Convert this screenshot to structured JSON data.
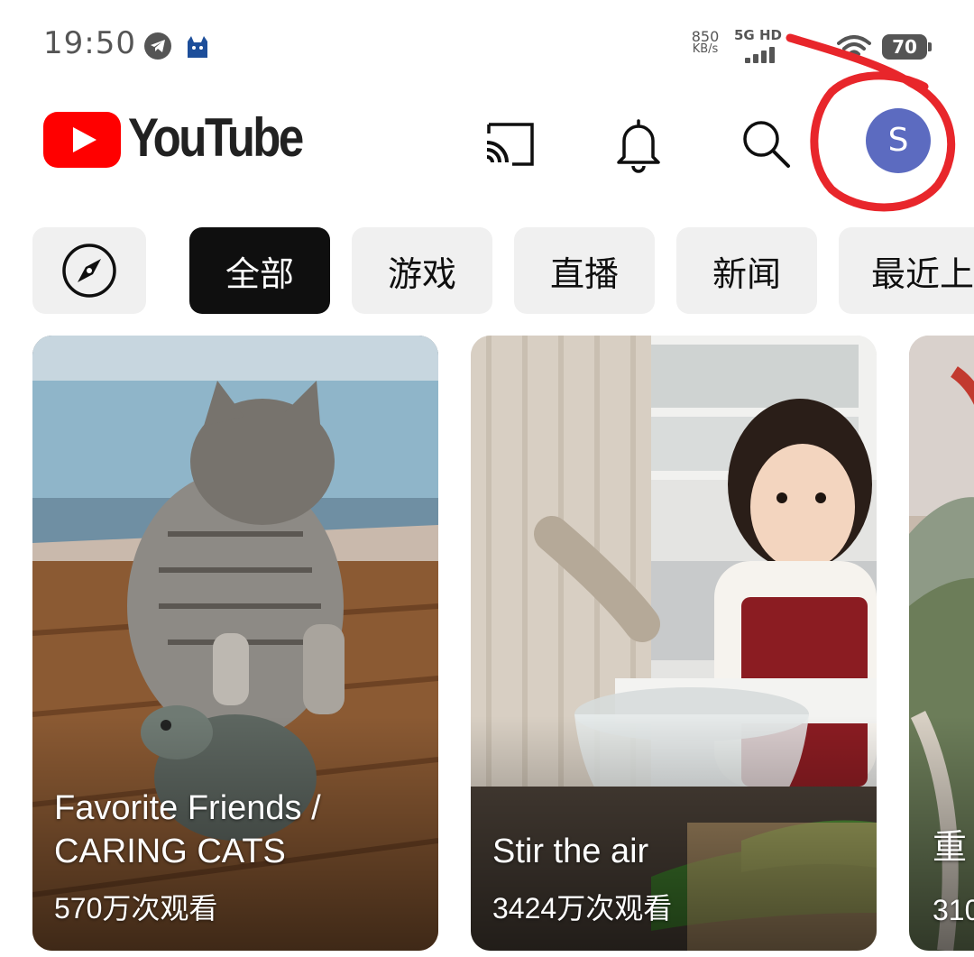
{
  "status_bar": {
    "time": "19:50",
    "net_speed_value": "850",
    "net_speed_unit": "KB/s",
    "network_label": "5G HD",
    "battery": "70"
  },
  "header": {
    "logo_text": "YouTube",
    "avatar_letter": "S",
    "brand_color": "#ff0000",
    "avatar_color": "#5c6bc0"
  },
  "chips": [
    "全部",
    "游戏",
    "直播",
    "新闻",
    "最近上"
  ],
  "active_chip": "全部",
  "shorts": [
    {
      "title": "Favorite Friends / CARING CATS",
      "views": "570万次观看"
    },
    {
      "title": "Stir the air",
      "views": "3424万次观看"
    },
    {
      "title": "重 的",
      "views": "310"
    }
  ],
  "icons": {
    "explore": "compass-icon",
    "cast": "cast-icon",
    "notifications": "bell-icon",
    "search": "search-icon"
  },
  "annotation_color": "#e8262b"
}
